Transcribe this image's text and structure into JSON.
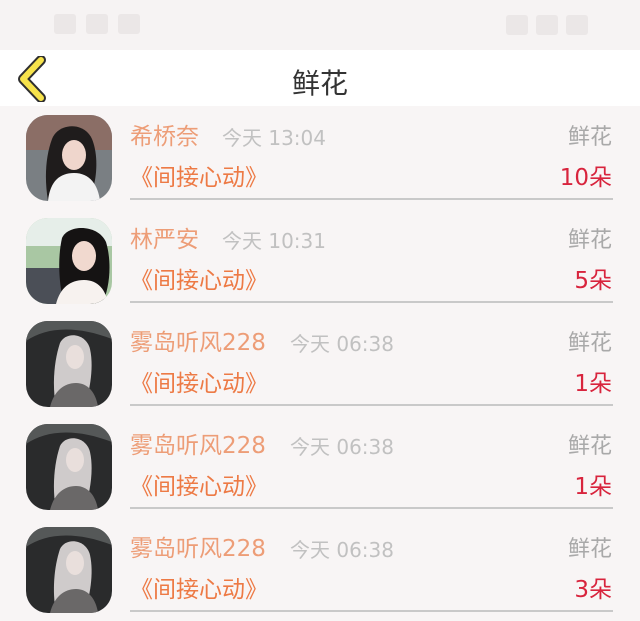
{
  "header": {
    "title": "鲜花",
    "back_icon": "chevron-left-icon"
  },
  "list": {
    "items": [
      {
        "name": "希桥奈",
        "time": "今天 13:04",
        "type": "鲜花",
        "title": "《间接心动》",
        "count": "10朵",
        "avatar": "girl-photo"
      },
      {
        "name": "林严安",
        "time": "今天 10:31",
        "type": "鲜花",
        "title": "《间接心动》",
        "count": "5朵",
        "avatar": "girl-photo"
      },
      {
        "name": "雾岛听风228",
        "time": "今天 06:38",
        "type": "鲜花",
        "title": "《间接心动》",
        "count": "1朵",
        "avatar": "girl-photo"
      },
      {
        "name": "雾岛听风228",
        "time": "今天 06:38",
        "type": "鲜花",
        "title": "《间接心动》",
        "count": "1朵",
        "avatar": "girl-photo"
      },
      {
        "name": "雾岛听风228",
        "time": "今天 06:38",
        "type": "鲜花",
        "title": "《间接心动》",
        "count": "3朵",
        "avatar": "girl-photo"
      }
    ]
  },
  "colors": {
    "name": "#ed9d77",
    "title": "#ed7a45",
    "count": "#d8243d",
    "back_icon_fill": "#f7e34b",
    "back_icon_stroke": "#2f2f2f"
  }
}
